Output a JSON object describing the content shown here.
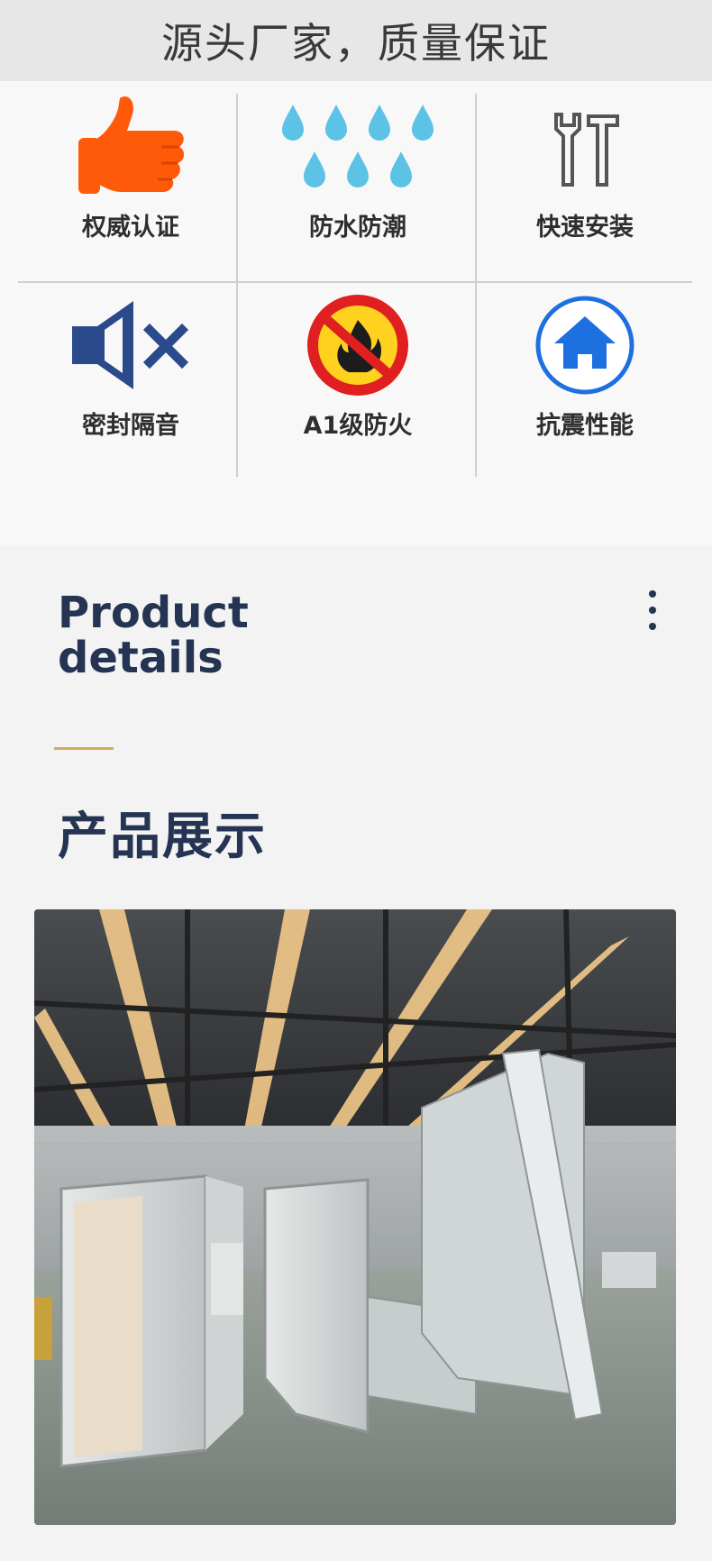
{
  "banner": {
    "text": "源头厂家，质量保证"
  },
  "features": [
    {
      "label": "权威认证",
      "icon": "thumbs-up-icon"
    },
    {
      "label": "防水防潮",
      "icon": "water-drops-icon"
    },
    {
      "label": "快速安装",
      "icon": "tools-icon"
    },
    {
      "label": "密封隔音",
      "icon": "mute-speaker-icon"
    },
    {
      "label": "A1级防火",
      "icon": "no-fire-icon"
    },
    {
      "label": "抗震性能",
      "icon": "home-icon"
    }
  ],
  "section": {
    "title_en_line1": "Product",
    "title_en_line2": "details",
    "title_cn": "产品展示"
  },
  "colors": {
    "title": "#243452",
    "accent": "#d9a95a",
    "thumb": "#ff5a0a",
    "drop": "#5cc3e6",
    "speaker": "#2b4a8c",
    "fire_red": "#e02020",
    "fire_yellow": "#ffd21f",
    "home_blue": "#1e6fe0"
  }
}
